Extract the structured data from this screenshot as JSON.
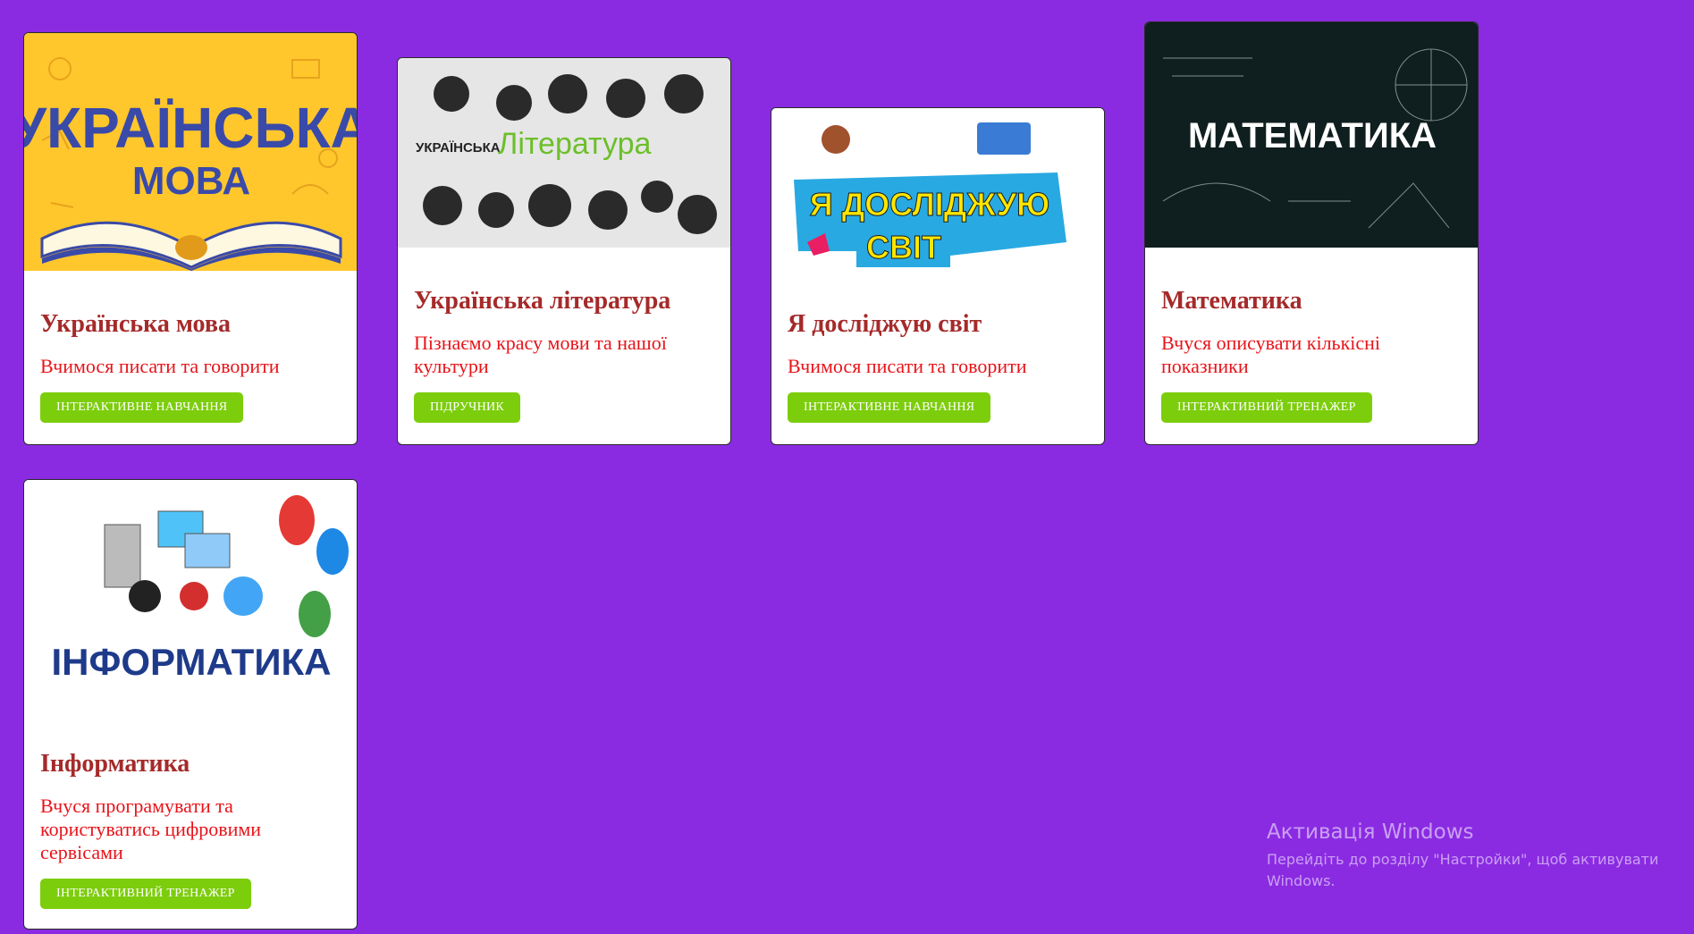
{
  "cards": [
    {
      "title": "Українська мова",
      "description": "Вчимося писати та говорити",
      "button": "ІНТЕРАКТИВНЕ НАВЧАННЯ",
      "image_text_1": "УКРАЇНСЬКА",
      "image_text_2": "МОВА",
      "image_bg": "#ffc72c"
    },
    {
      "title": "Українська література",
      "description": "Пізнаємо красу мови та нашої культури",
      "button": "ПІДРУЧНИК",
      "image_text_1": "УКРАЇНСЬКА",
      "image_text_2": "Література",
      "image_bg": "#e6e6e6"
    },
    {
      "title": "Я досліджую світ",
      "description": "Вчимося писати та говорити",
      "button": "ІНТЕРАКТИВНЕ НАВЧАННЯ",
      "image_text_1": "Я ДОСЛІДЖУЮ",
      "image_text_2": "СВІТ",
      "image_bg": "#ffffff"
    },
    {
      "title": "Математика",
      "description": "Вчуся описувати кількісні показники",
      "button": "ІНТЕРАКТИВНИЙ ТРЕНАЖЕР",
      "image_text_1": "МАТЕМАТИКА",
      "image_bg": "#0f1e1e"
    },
    {
      "title": "Інформатика",
      "description": "Вчуся програмувати та користуватись цифровими сервісами",
      "button": "ІНТЕРАКТИВНИЙ ТРЕНАЖЕР",
      "image_text_1": "ІНФОРМАТИКА",
      "image_bg": "#ffffff"
    }
  ],
  "watermark": {
    "title": "Активація Windows",
    "subtitle": "Перейдіть до розділу \"Настройки\", щоб активувати Windows."
  }
}
